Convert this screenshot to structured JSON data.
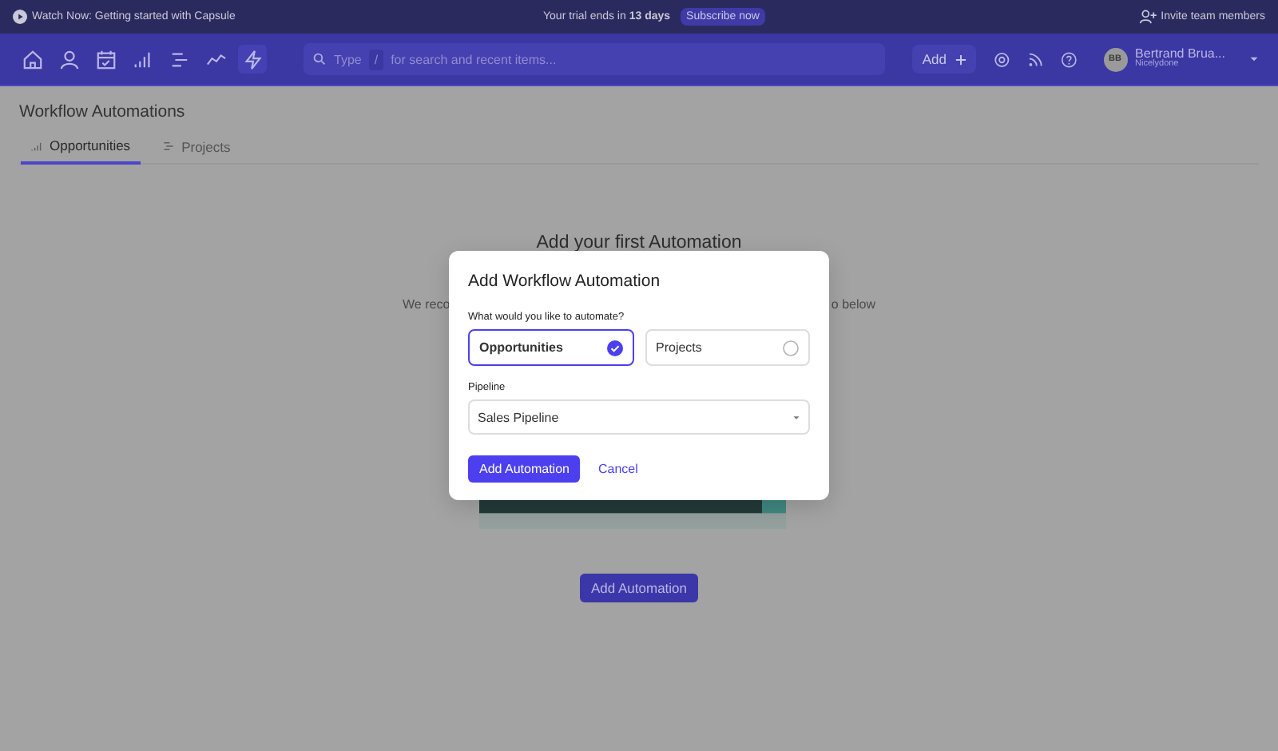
{
  "banner": {
    "video_link": "Watch Now: Getting started with Capsule",
    "trial_prefix": "Your trial ends in ",
    "trial_days": "13 days",
    "subscribe": "Subscribe now",
    "invite": "Invite team members"
  },
  "nav": {
    "items": [
      {
        "kind": "home",
        "selected": false
      },
      {
        "kind": "person",
        "selected": false
      },
      {
        "kind": "calendar",
        "selected": false
      },
      {
        "kind": "bars",
        "selected": false
      },
      {
        "kind": "lines",
        "selected": false
      },
      {
        "kind": "trend",
        "selected": false
      },
      {
        "kind": "bolt",
        "selected": true
      }
    ],
    "search": {
      "placeholder_before": "Type",
      "key": "/",
      "placeholder": "for search and recent items..."
    },
    "add": "Add",
    "user": {
      "initials": "BB",
      "name": "Bertrand Brua...",
      "account": "Nicelydone"
    }
  },
  "page": {
    "title": "Workflow Automations",
    "tabs": [
      {
        "label": "Opportunities",
        "kind": "bars",
        "selected": true
      },
      {
        "label": "Projects",
        "kind": "lines",
        "selected": false
      }
    ]
  },
  "empty_state": {
    "heading": "Add your first Automation",
    "text_left": "We reco",
    "text_right": "o below",
    "button": "Add Automation"
  },
  "dialog": {
    "title": "Add Workflow Automation",
    "question": "What would you like to automate?",
    "options": [
      {
        "label": "Opportunities",
        "selected": true
      },
      {
        "label": "Projects",
        "selected": false
      }
    ],
    "pipeline_label": "Pipeline",
    "pipeline_value": "Sales Pipeline",
    "submit": "Add Automation",
    "cancel": "Cancel"
  }
}
